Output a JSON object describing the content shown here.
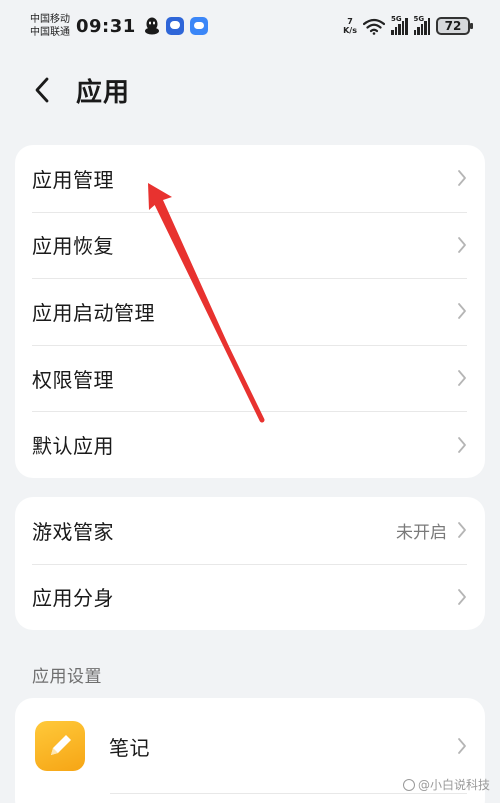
{
  "status_bar": {
    "carrier_1": "中国移动",
    "carrier_2": "中国联通",
    "time": "09:31",
    "net_speed_value": "7",
    "net_speed_unit": "K/s",
    "signal_1_label": "5G",
    "signal_2_label": "5G",
    "battery": "72"
  },
  "header": {
    "title": "应用"
  },
  "group_1": {
    "items": [
      {
        "label": "应用管理"
      },
      {
        "label": "应用恢复"
      },
      {
        "label": "应用启动管理"
      },
      {
        "label": "权限管理"
      },
      {
        "label": "默认应用"
      }
    ]
  },
  "group_2": {
    "items": [
      {
        "label": "游戏管家",
        "value": "未开启"
      },
      {
        "label": "应用分身"
      }
    ]
  },
  "app_settings": {
    "section_title": "应用设置",
    "items": [
      {
        "label": "笔记",
        "icon": "notes-app-icon"
      }
    ]
  },
  "watermark": "@小白说科技",
  "colors": {
    "background": "#f1f3f5",
    "card": "#ffffff",
    "annotation_arrow": "#e8322f",
    "notes_icon": "#f6a515"
  }
}
